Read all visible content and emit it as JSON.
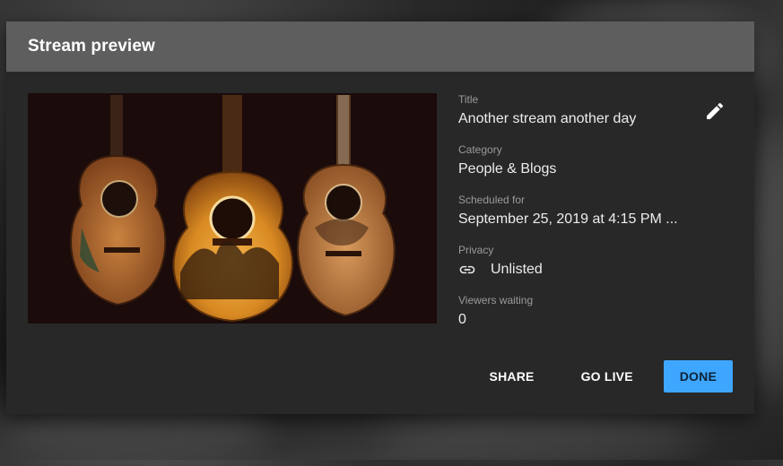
{
  "dialog": {
    "title": "Stream preview"
  },
  "thumbnail": {
    "alt": "Three vintage acoustic guitars with painted decorations"
  },
  "details": {
    "title_label": "Title",
    "title_value": "Another stream another day",
    "category_label": "Category",
    "category_value": "People & Blogs",
    "scheduled_label": "Scheduled for",
    "scheduled_value": "September 25, 2019 at 4:15 PM ...",
    "privacy_label": "Privacy",
    "privacy_value": "Unlisted",
    "viewers_label": "Viewers waiting",
    "viewers_value": "0"
  },
  "actions": {
    "share_label": "SHARE",
    "go_live_label": "GO LIVE",
    "done_label": "DONE"
  },
  "icons": {
    "edit": "pencil-icon",
    "privacy": "link-icon"
  },
  "colors": {
    "accent": "#3ea6ff",
    "header_bg": "#5e5e5e",
    "dialog_bg": "#282828"
  }
}
